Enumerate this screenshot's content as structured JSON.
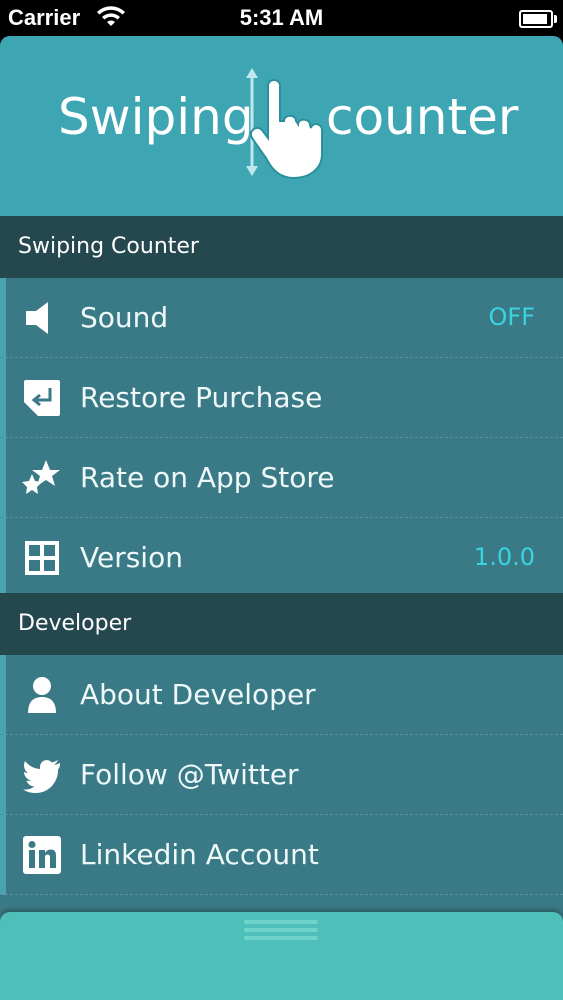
{
  "status_bar": {
    "carrier": "Carrier",
    "time": "5:31 AM"
  },
  "header": {
    "logo_left": "Swiping",
    "logo_right": "counter"
  },
  "sections": [
    {
      "title": "Swiping Counter",
      "items": [
        {
          "label": "Sound",
          "value": "OFF",
          "icon": "speaker-icon"
        },
        {
          "label": "Restore Purchase",
          "value": "",
          "icon": "restore-icon"
        },
        {
          "label": "Rate on App Store",
          "value": "",
          "icon": "stars-icon"
        },
        {
          "label": "Version",
          "value": "1.0.0",
          "icon": "grid-icon"
        }
      ]
    },
    {
      "title": "Developer",
      "items": [
        {
          "label": "About Developer",
          "icon": "person-icon"
        },
        {
          "label": "Follow @Twitter",
          "icon": "twitter-icon"
        },
        {
          "label": "Linkedin Account",
          "icon": "linkedin-icon"
        }
      ]
    }
  ],
  "colors": {
    "accent": "#3ad4e0",
    "header_bg": "#3ea6b3",
    "panel_bg": "#3a7a86",
    "section_bg": "#25474e",
    "handle_bg": "#4ec0b9"
  }
}
